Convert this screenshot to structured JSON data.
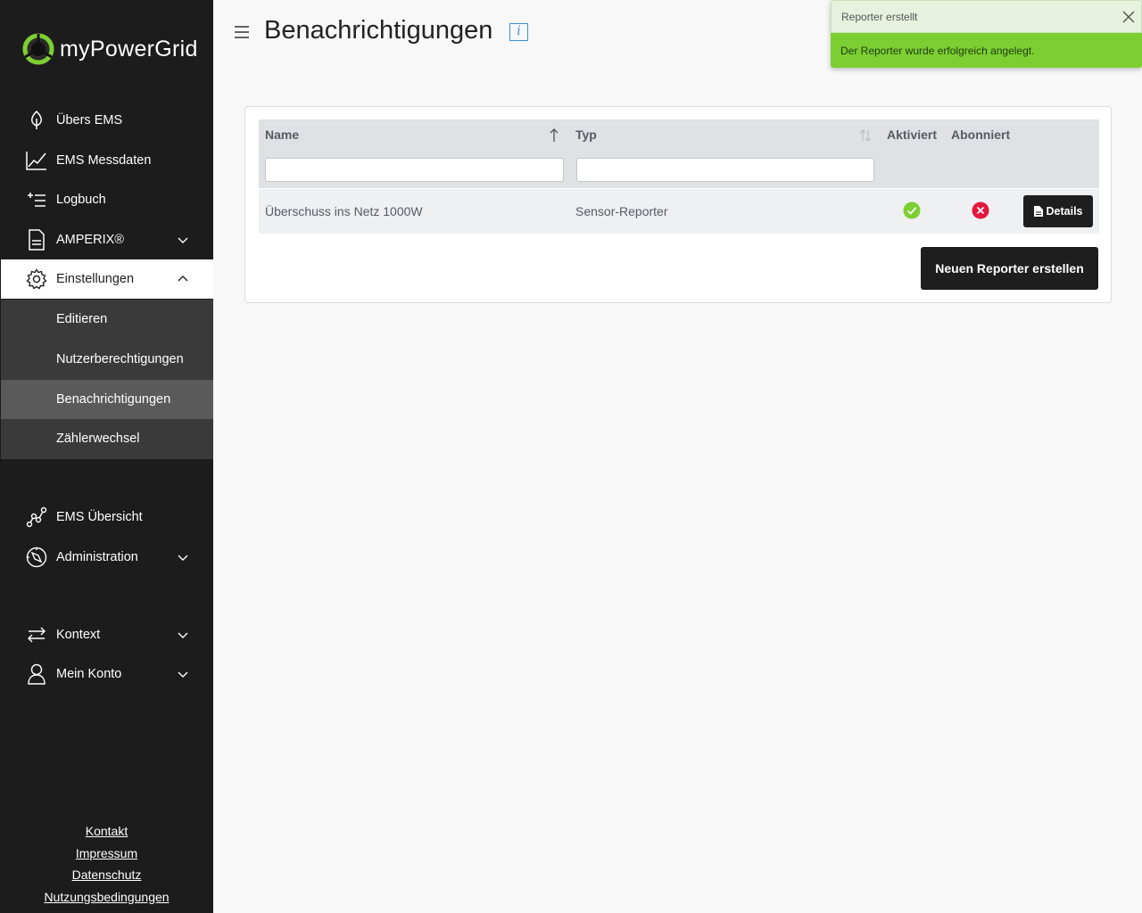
{
  "app": {
    "logo_text": "myPowerGrid",
    "brand_color": "#7ccf32",
    "sidebar_color": "#1c1c1c"
  },
  "sidebar": {
    "items": [
      {
        "label": "Übers EMS",
        "icon": "leaf-icon"
      },
      {
        "label": "EMS Messdaten",
        "icon": "chart-line-icon"
      },
      {
        "label": "Logbuch",
        "icon": "list-plus-icon"
      },
      {
        "label": "AMPERIX®",
        "icon": "document-icon",
        "expandable": true
      },
      {
        "label": "Einstellungen",
        "icon": "gear-icon",
        "expandable": true,
        "expanded": true,
        "active": true
      },
      {
        "label": "EMS Übersicht",
        "icon": "network-graph-icon"
      },
      {
        "label": "Administration",
        "icon": "compass-icon",
        "expandable": true
      },
      {
        "label": "Kontext",
        "icon": "swap-arrows-icon",
        "expandable": true
      },
      {
        "label": "Mein Konto",
        "icon": "user-icon",
        "expandable": true
      }
    ],
    "submenu": [
      {
        "label": "Editieren"
      },
      {
        "label": "Nutzerberechtigungen"
      },
      {
        "label": "Benachrichtigungen",
        "current": true
      },
      {
        "label": "Zählerwechsel"
      }
    ],
    "footer_links": [
      "Kontakt",
      "Impressum",
      "Datenschutz",
      "Nutzungsbedingungen"
    ]
  },
  "header": {
    "title": "Benachrichtigungen",
    "info_glyph": "i"
  },
  "table": {
    "columns": [
      "Name",
      "Typ",
      "Aktiviert",
      "Abonniert"
    ],
    "sort": {
      "Name": "ascending",
      "Typ": "unsorted"
    },
    "filters": {
      "name_value": "",
      "typ_value": ""
    },
    "rows": [
      {
        "name": "Überschuss ins Netz 1000W",
        "typ": "Sensor-Reporter",
        "aktiviert": true,
        "abonniert": false,
        "action_label": "Details"
      }
    ]
  },
  "actions": {
    "create_label": "Neuen Reporter erstellen"
  },
  "toast": {
    "title": "Reporter erstellt",
    "message": "Der Reporter wurde erfolgreich angelegt.",
    "status_color": "#7ccf32"
  }
}
